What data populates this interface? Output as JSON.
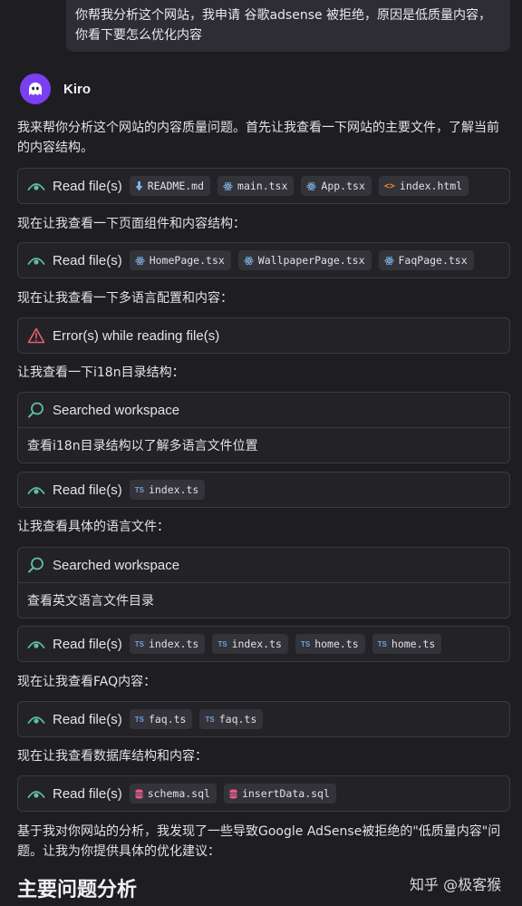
{
  "user_message": "你帮我分析这个网站，我申请 谷歌adsense 被拒绝，原因是低质量内容，你看下要怎么优化内容",
  "agent": {
    "name": "Kiro"
  },
  "intro_text": "我来帮你分析这个网站的内容质量问题。首先让我查看一下网站的主要文件，了解当前的内容结构。",
  "blocks": {
    "read1": {
      "label": "Read file(s)",
      "files": [
        "README.md",
        "main.tsx",
        "App.tsx",
        "index.html"
      ]
    },
    "text1": "现在让我查看一下页面组件和内容结构：",
    "read2": {
      "label": "Read file(s)",
      "files": [
        "HomePage.tsx",
        "WallpaperPage.tsx",
        "FaqPage.tsx"
      ]
    },
    "text2": "现在让我查看一下多语言配置和内容：",
    "error1": {
      "label": "Error(s) while reading file(s)"
    },
    "text3": "让我查看一下i18n目录结构：",
    "search1": {
      "label": "Searched workspace",
      "detail": "查看i18n目录结构以了解多语言文件位置"
    },
    "read3": {
      "label": "Read file(s)",
      "files": [
        "index.ts"
      ]
    },
    "text4": "让我查看具体的语言文件：",
    "search2": {
      "label": "Searched workspace",
      "detail": "查看英文语言文件目录"
    },
    "read4": {
      "label": "Read file(s)",
      "files": [
        "index.ts",
        "index.ts",
        "home.ts",
        "home.ts"
      ]
    },
    "text5": "现在让我查看FAQ内容：",
    "read5": {
      "label": "Read file(s)",
      "files": [
        "faq.ts",
        "faq.ts"
      ]
    },
    "text6": "现在让我查看数据库结构和内容：",
    "read6": {
      "label": "Read file(s)",
      "files": [
        "schema.sql",
        "insertData.sql"
      ]
    },
    "text7": "基于我对你网站的分析，我发现了一些导致Google AdSense被拒绝的\"低质量内容\"问题。让我为你提供具体的优化建议："
  },
  "section_heading": "主要问题分析",
  "watermark": "知乎 @极客猴",
  "icon_names": {
    "read": "eye-icon",
    "search": "search-icon",
    "error": "warning-triangle-icon",
    "md": "markdown-file-icon",
    "tsx": "react-file-icon",
    "html": "html-file-icon",
    "ts": "typescript-file-icon",
    "sql": "database-file-icon"
  },
  "colors": {
    "background": "#1e1d22",
    "card_bg": "#232227",
    "card_border": "#3b3a41",
    "chip_bg": "#34333a",
    "accent_green": "#5fc09a",
    "error_red": "#e4606a",
    "avatar_purple": "#7b3ff2",
    "react_blue": "#7eb3e8",
    "ts_blue": "#6aa0d8",
    "sql_pink": "#e25b84",
    "html_orange": "#e8863a"
  }
}
